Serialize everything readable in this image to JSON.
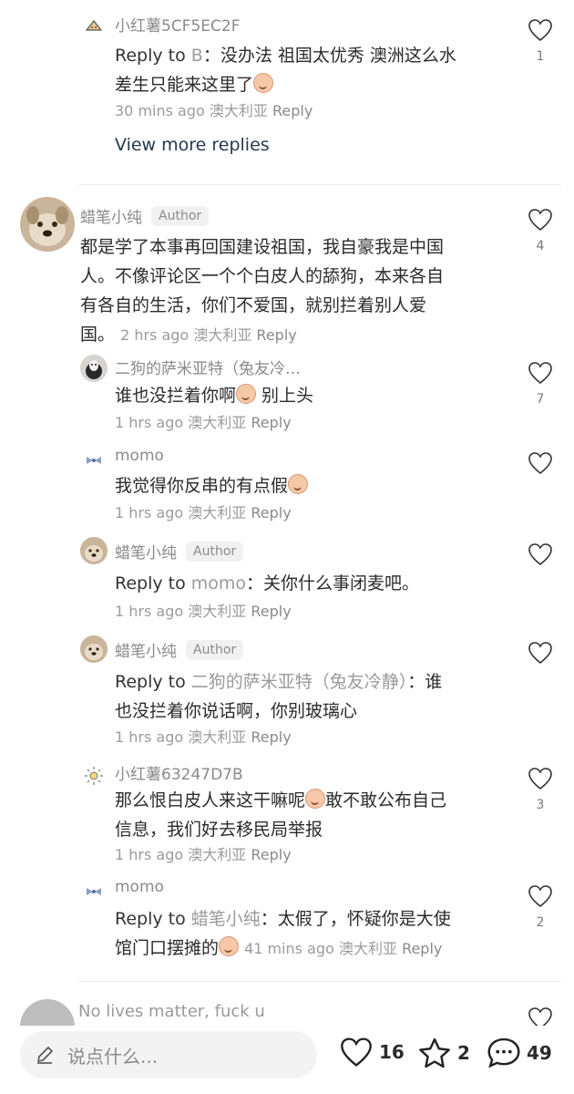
{
  "comments": [
    {
      "name": "小红薯5CF5EC2F",
      "reply_prefix": "Reply to ",
      "reply_target": "B",
      "text_line1": "：没办法 祖国太优秀 澳洲这么水",
      "text_line2": "差生只能来这里了",
      "time": "30 mins ago",
      "location": "澳大利亚",
      "reply_label": "Reply",
      "likes": "1"
    },
    {
      "name": "蜡笔小纯",
      "badge": "Author",
      "text_line1": "都是学了本事再回国建设祖国，我自豪我是中国",
      "text_line2": "人。不像评论区一个个白皮人的舔狗，本来各自",
      "text_line3": "有各自的生活，你们不爱国，就别拦着别人爱",
      "text_line4": "国。",
      "time": "2 hrs ago",
      "location": "澳大利亚",
      "reply_label": "Reply",
      "likes": "4"
    },
    {
      "name": "二狗的萨米亚特（兔友冷…",
      "text_a": "谁也没拦着你啊",
      "text_b": " 别上头",
      "time": "1 hrs ago",
      "location": "澳大利亚",
      "reply_label": "Reply",
      "likes": "7"
    },
    {
      "name": "momo",
      "text": "我觉得你反串的有点假",
      "time": "1 hrs ago",
      "location": "澳大利亚",
      "reply_label": "Reply"
    },
    {
      "name": "蜡笔小纯",
      "badge": "Author",
      "reply_prefix": "Reply to ",
      "reply_target": "momo",
      "text": "：关你什么事闭麦吧。",
      "time": "1 hrs ago",
      "location": "澳大利亚",
      "reply_label": "Reply"
    },
    {
      "name": "蜡笔小纯",
      "badge": "Author",
      "reply_prefix": "Reply to ",
      "reply_target": "二狗的萨米亚特（兔友冷静）",
      "text_line1": "：谁",
      "text_line2": "也没拦着你说话啊，你别玻璃心",
      "time": "1 hrs ago",
      "location": "澳大利亚",
      "reply_label": "Reply"
    },
    {
      "name": "小红薯63247D7B",
      "text_line1a": "那么恨白皮人来这干嘛呢",
      "text_line1b": "敢不敢公布自己",
      "text_line2": "信息，我们好去移民局举报",
      "time": "1 hrs ago",
      "location": "澳大利亚",
      "reply_label": "Reply",
      "likes": "3"
    },
    {
      "name": "momo",
      "reply_prefix": "Reply to ",
      "reply_target": "蜡笔小纯",
      "text_line1": "：太假了，怀疑你是大使",
      "text_line2": "馆门口摆摊的",
      "time": "41 mins ago",
      "location": "澳大利亚",
      "reply_label": "Reply",
      "likes": "2"
    }
  ],
  "view_more": "View more replies",
  "partial_comment": "No lives matter, fuck u",
  "bottom_bar": {
    "placeholder": "说点什么...",
    "likes": "16",
    "favorites": "2",
    "comments": "49"
  },
  "colors": {
    "accent_link": "#25384e",
    "muted_text": "#9b9b9b"
  }
}
